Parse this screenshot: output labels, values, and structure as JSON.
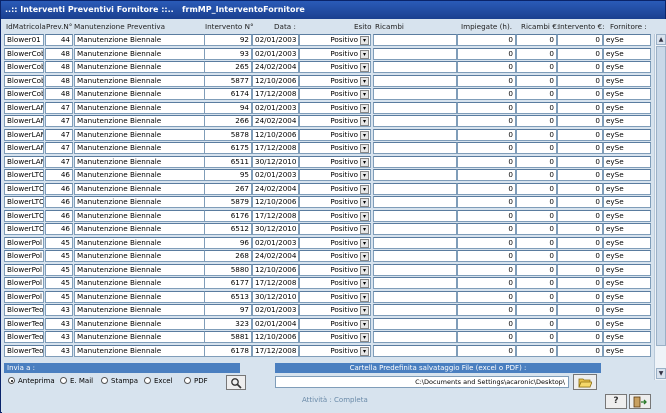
{
  "window": {
    "title_prefix": "..:: Interventi Preventivi Fornitore ::..",
    "title_form": "frmMP_InterventoFornitore"
  },
  "columns": {
    "idmatricola": "IdMatricola",
    "prev": "Prev.N°",
    "manutenzione": "Manutenzione Preventiva",
    "intervento": "Intervento N°",
    "data": "Data :",
    "esito": "Esito",
    "ricambi": "Ricambi",
    "impiegate": "Impiegate (h).",
    "ricambi_eur": "Ricambi €:",
    "intervento_eur": "Intervento €:",
    "fornitore": "Fornitore :"
  },
  "rows": [
    {
      "id": "Blower01",
      "prev": "44",
      "man": "Manutenzione Biennale",
      "int": "92",
      "data": "02/01/2003",
      "esito": "Positivo",
      "ricambi": "",
      "imp": "0",
      "reur": "0",
      "ieur": "0",
      "forn": "eySe"
    },
    {
      "id": "BlowerCob",
      "prev": "48",
      "man": "Manutenzione Biennale",
      "int": "93",
      "data": "02/01/2003",
      "esito": "Positivo",
      "ricambi": "",
      "imp": "0",
      "reur": "0",
      "ieur": "0",
      "forn": "eySe"
    },
    {
      "id": "BlowerCob",
      "prev": "48",
      "man": "Manutenzione Biennale",
      "int": "265",
      "data": "24/02/2004",
      "esito": "Positivo",
      "ricambi": "",
      "imp": "0",
      "reur": "0",
      "ieur": "0",
      "forn": "eySe"
    },
    {
      "id": "BlowerCob",
      "prev": "48",
      "man": "Manutenzione Biennale",
      "int": "5877",
      "data": "12/10/2006",
      "esito": "Positivo",
      "ricambi": "",
      "imp": "0",
      "reur": "0",
      "ieur": "0",
      "forn": "eySe"
    },
    {
      "id": "BlowerCob",
      "prev": "48",
      "man": "Manutenzione Biennale",
      "int": "6174",
      "data": "17/12/2008",
      "esito": "Positivo",
      "ricambi": "",
      "imp": "0",
      "reur": "0",
      "ieur": "0",
      "forn": "eySe"
    },
    {
      "id": "BlowerLAM",
      "prev": "47",
      "man": "Manutenzione Biennale",
      "int": "94",
      "data": "02/01/2003",
      "esito": "Positivo",
      "ricambi": "",
      "imp": "0",
      "reur": "0",
      "ieur": "0",
      "forn": "eySe"
    },
    {
      "id": "BlowerLAM",
      "prev": "47",
      "man": "Manutenzione Biennale",
      "int": "266",
      "data": "24/02/2004",
      "esito": "Positivo",
      "ricambi": "",
      "imp": "0",
      "reur": "0",
      "ieur": "0",
      "forn": "eySe"
    },
    {
      "id": "BlowerLAM",
      "prev": "47",
      "man": "Manutenzione Biennale",
      "int": "5878",
      "data": "12/10/2006",
      "esito": "Positivo",
      "ricambi": "",
      "imp": "0",
      "reur": "0",
      "ieur": "0",
      "forn": "eySe"
    },
    {
      "id": "BlowerLAM",
      "prev": "47",
      "man": "Manutenzione Biennale",
      "int": "6175",
      "data": "17/12/2008",
      "esito": "Positivo",
      "ricambi": "",
      "imp": "0",
      "reur": "0",
      "ieur": "0",
      "forn": "eySe"
    },
    {
      "id": "BlowerLAM",
      "prev": "47",
      "man": "Manutenzione Biennale",
      "int": "6511",
      "data": "30/12/2010",
      "esito": "Positivo",
      "ricambi": "",
      "imp": "0",
      "reur": "0",
      "ieur": "0",
      "forn": "eySe"
    },
    {
      "id": "BlowerLTO",
      "prev": "46",
      "man": "Manutenzione Biennale",
      "int": "95",
      "data": "02/01/2003",
      "esito": "Positivo",
      "ricambi": "",
      "imp": "0",
      "reur": "0",
      "ieur": "0",
      "forn": "eySe"
    },
    {
      "id": "BlowerLTO",
      "prev": "46",
      "man": "Manutenzione Biennale",
      "int": "267",
      "data": "24/02/2004",
      "esito": "Positivo",
      "ricambi": "",
      "imp": "0",
      "reur": "0",
      "ieur": "0",
      "forn": "eySe"
    },
    {
      "id": "BlowerLTO",
      "prev": "46",
      "man": "Manutenzione Biennale",
      "int": "5879",
      "data": "12/10/2006",
      "esito": "Positivo",
      "ricambi": "",
      "imp": "0",
      "reur": "0",
      "ieur": "0",
      "forn": "eySe"
    },
    {
      "id": "BlowerLTO",
      "prev": "46",
      "man": "Manutenzione Biennale",
      "int": "6176",
      "data": "17/12/2008",
      "esito": "Positivo",
      "ricambi": "",
      "imp": "0",
      "reur": "0",
      "ieur": "0",
      "forn": "eySe"
    },
    {
      "id": "BlowerLTO",
      "prev": "46",
      "man": "Manutenzione Biennale",
      "int": "6512",
      "data": "30/12/2010",
      "esito": "Positivo",
      "ricambi": "",
      "imp": "0",
      "reur": "0",
      "ieur": "0",
      "forn": "eySe"
    },
    {
      "id": "BlowerPol",
      "prev": "45",
      "man": "Manutenzione Biennale",
      "int": "96",
      "data": "02/01/2003",
      "esito": "Positivo",
      "ricambi": "",
      "imp": "0",
      "reur": "0",
      "ieur": "0",
      "forn": "eySe"
    },
    {
      "id": "BlowerPol",
      "prev": "45",
      "man": "Manutenzione Biennale",
      "int": "268",
      "data": "24/02/2004",
      "esito": "Positivo",
      "ricambi": "",
      "imp": "0",
      "reur": "0",
      "ieur": "0",
      "forn": "eySe"
    },
    {
      "id": "BlowerPol",
      "prev": "45",
      "man": "Manutenzione Biennale",
      "int": "5880",
      "data": "12/10/2006",
      "esito": "Positivo",
      "ricambi": "",
      "imp": "0",
      "reur": "0",
      "ieur": "0",
      "forn": "eySe"
    },
    {
      "id": "BlowerPol",
      "prev": "45",
      "man": "Manutenzione Biennale",
      "int": "6177",
      "data": "17/12/2008",
      "esito": "Positivo",
      "ricambi": "",
      "imp": "0",
      "reur": "0",
      "ieur": "0",
      "forn": "eySe"
    },
    {
      "id": "BlowerPol",
      "prev": "45",
      "man": "Manutenzione Biennale",
      "int": "6513",
      "data": "30/12/2010",
      "esito": "Positivo",
      "ricambi": "",
      "imp": "0",
      "reur": "0",
      "ieur": "0",
      "forn": "eySe"
    },
    {
      "id": "BlowerTeo",
      "prev": "43",
      "man": "Manutenzione Biennale",
      "int": "97",
      "data": "02/01/2003",
      "esito": "Positivo",
      "ricambi": "",
      "imp": "0",
      "reur": "0",
      "ieur": "0",
      "forn": "eySe"
    },
    {
      "id": "BlowerTeo",
      "prev": "43",
      "man": "Manutenzione Biennale",
      "int": "323",
      "data": "02/01/2004",
      "esito": "Positivo",
      "ricambi": "",
      "imp": "0",
      "reur": "0",
      "ieur": "0",
      "forn": "eySe"
    },
    {
      "id": "BlowerTeo",
      "prev": "43",
      "man": "Manutenzione Biennale",
      "int": "5881",
      "data": "12/10/2006",
      "esito": "Positivo",
      "ricambi": "",
      "imp": "0",
      "reur": "0",
      "ieur": "0",
      "forn": "eySe"
    },
    {
      "id": "BlowerTeo",
      "prev": "43",
      "man": "Manutenzione Biennale",
      "int": "6178",
      "data": "17/12/2008",
      "esito": "Positivo",
      "ricambi": "",
      "imp": "0",
      "reur": "0",
      "ieur": "0",
      "forn": "eySe"
    }
  ],
  "invia": {
    "label": "Invia a :",
    "options": [
      "Anteprima",
      "E. Mail",
      "Stampa",
      "Excel",
      "PDF"
    ],
    "selected": "Anteprima"
  },
  "folder": {
    "label": "Cartella Predefinita salvataggio File (excel o PDF) :",
    "path": "C:\\Documents and Settings\\acaronic\\Desktop\\"
  },
  "status_text": "Attività : Completa",
  "icons": {
    "preview": "magnifier-icon",
    "folder": "folder-open-icon",
    "help": "help-icon",
    "exit": "exit-door-icon"
  }
}
